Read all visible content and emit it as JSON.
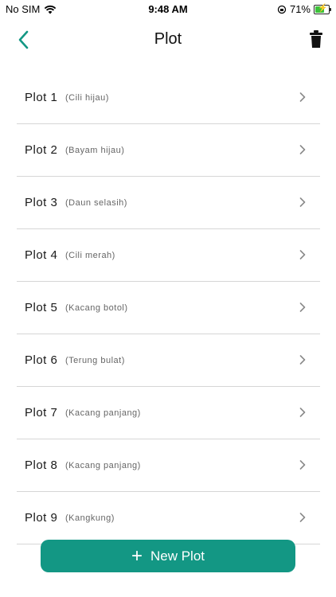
{
  "status_bar": {
    "carrier": "No SIM",
    "time": "9:48 AM",
    "battery_percent": "71%",
    "battery_level": 0.71
  },
  "header": {
    "title": "Plot",
    "accent_color": "#139784"
  },
  "plots": [
    {
      "name": "Plot 1",
      "crop": "(Cili hijau)"
    },
    {
      "name": "Plot 2",
      "crop": "(Bayam hijau)"
    },
    {
      "name": "Plot 3",
      "crop": "(Daun selasih)"
    },
    {
      "name": "Plot 4",
      "crop": "(Cili merah)"
    },
    {
      "name": "Plot 5",
      "crop": "(Kacang botol)"
    },
    {
      "name": "Plot 6",
      "crop": "(Terung bulat)"
    },
    {
      "name": "Plot 7",
      "crop": "(Kacang panjang)"
    },
    {
      "name": "Plot 8",
      "crop": "(Kacang panjang)"
    },
    {
      "name": "Plot 9",
      "crop": "(Kangkung)"
    }
  ],
  "footer": {
    "new_plot_label": "New Plot"
  },
  "icons": {
    "back": "chevron-left-icon",
    "delete": "trash-icon",
    "row": "chevron-right-icon",
    "add": "plus-icon"
  }
}
